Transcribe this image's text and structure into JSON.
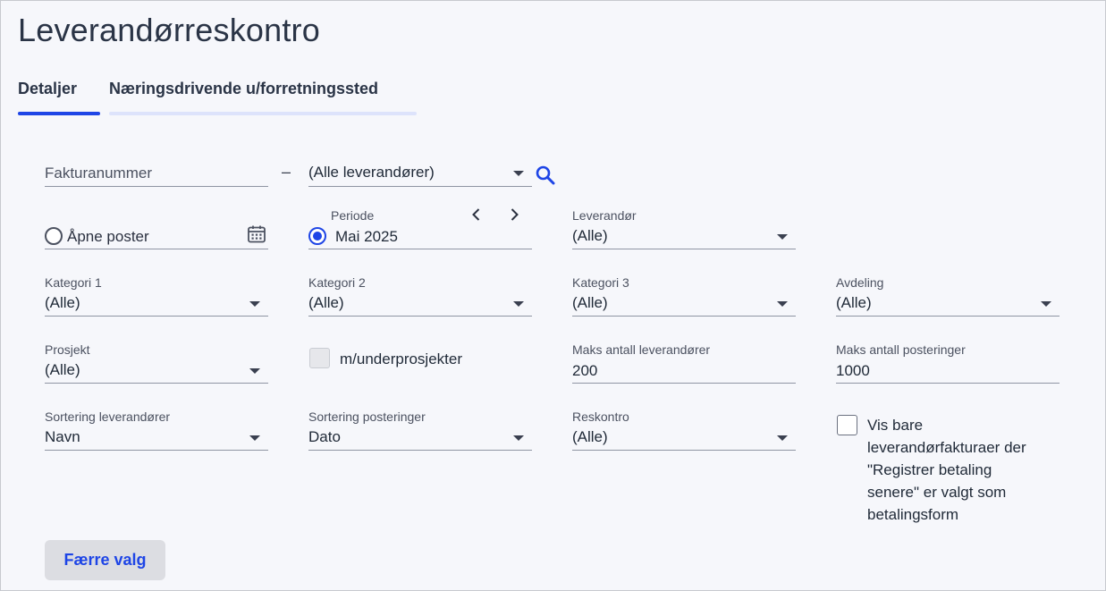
{
  "page": {
    "title": "Leverandørreskontro"
  },
  "tabs": [
    {
      "label": "Detaljer",
      "active": true
    },
    {
      "label": "Næringsdrivende u/forretningssted",
      "active": false
    }
  ],
  "filters": {
    "invoice_number": {
      "placeholder": "Fakturanummer",
      "value": ""
    },
    "supplier_select": {
      "value": "(Alle leverandører)"
    },
    "open_items": {
      "label": "Åpne poster",
      "selected": false
    },
    "period": {
      "label": "Periode",
      "value": "Mai 2025",
      "selected": true
    },
    "supplier": {
      "label": "Leverandør",
      "value": "(Alle)"
    },
    "category1": {
      "label": "Kategori 1",
      "value": "(Alle)"
    },
    "category2": {
      "label": "Kategori 2",
      "value": "(Alle)"
    },
    "category3": {
      "label": "Kategori 3",
      "value": "(Alle)"
    },
    "department": {
      "label": "Avdeling",
      "value": "(Alle)"
    },
    "project": {
      "label": "Prosjekt",
      "value": "(Alle)"
    },
    "subprojects": {
      "label": "m/underprosjekter",
      "checked": false,
      "disabled": true
    },
    "max_suppliers": {
      "label": "Maks antall leverandører",
      "value": "200"
    },
    "max_postings": {
      "label": "Maks antall posteringer",
      "value": "1000"
    },
    "sort_suppliers": {
      "label": "Sortering leverandører",
      "value": "Navn"
    },
    "sort_postings": {
      "label": "Sortering posteringer",
      "value": "Dato"
    },
    "ledger": {
      "label": "Reskontro",
      "value": "(Alle)"
    },
    "only_register_later": {
      "label_lines": [
        "Vis bare",
        "leverandørfakturaer der",
        "\"Registrer betaling",
        "senere\" er valgt som",
        "betalingsform"
      ],
      "checked": false
    }
  },
  "actions": {
    "fewer_options": "Færre valg"
  },
  "colors": {
    "accent": "#1e45e6",
    "background": "#f6f7fb",
    "tab_inactive_underline": "#dde3fb"
  },
  "icons": {
    "search": "search-icon",
    "calendar": "calendar-icon",
    "prev": "chevron-left-icon",
    "next": "chevron-right-icon",
    "dropdown": "caret-down-icon"
  }
}
